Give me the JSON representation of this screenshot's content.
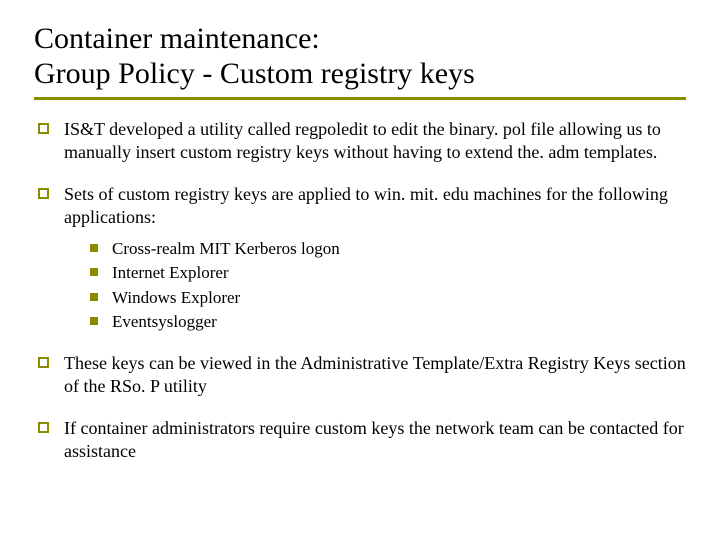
{
  "title_line1": "Container maintenance:",
  "title_line2": "Group Policy - Custom registry keys",
  "bullets": [
    "IS&T developed a utility called regpoledit to edit the binary. pol file allowing us to manually insert custom registry keys without having to extend the. adm templates.",
    "Sets of custom registry keys are applied to win. mit. edu machines for the following applications:",
    "These keys can be viewed in the Administrative Template/Extra Registry Keys section of the RSo. P utility",
    "If container administrators require custom keys the network team can be contacted for assistance"
  ],
  "sub_bullets": [
    "Cross-realm MIT Kerberos logon",
    "Internet Explorer",
    "Windows Explorer",
    "Eventsyslogger"
  ]
}
